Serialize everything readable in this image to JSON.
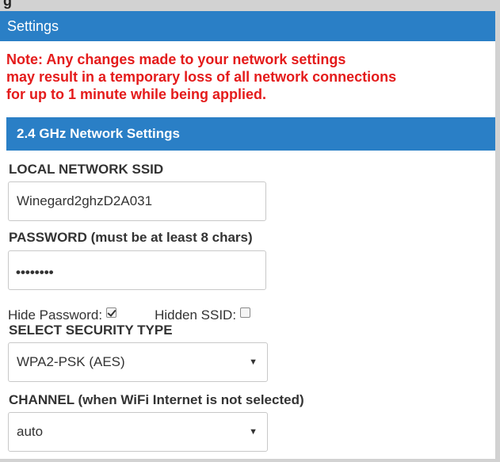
{
  "header": {
    "title": "Settings"
  },
  "note": {
    "lines": [
      "Note: Any changes made to your network settings",
      "may result in a temporary loss of all network connections",
      "for up to 1 minute while being applied."
    ]
  },
  "section": {
    "title": "2.4 GHz Network Settings"
  },
  "ssid": {
    "label": "LOCAL NETWORK SSID",
    "value": "Winegard2ghzD2A031"
  },
  "password": {
    "label": "PASSWORD (must be at least 8 chars)",
    "masked": "••••••••"
  },
  "options": {
    "hide_password_label": "Hide Password:",
    "hide_password_checked": true,
    "hidden_ssid_label": "Hidden SSID:",
    "hidden_ssid_checked": false
  },
  "security": {
    "label": "SELECT SECURITY TYPE",
    "selected": "WPA2-PSK (AES)"
  },
  "channel": {
    "label": "CHANNEL (when WiFi Internet is not selected)",
    "selected": "auto"
  },
  "colors": {
    "accent": "#2a7fc6",
    "warning": "#e41b1b"
  }
}
